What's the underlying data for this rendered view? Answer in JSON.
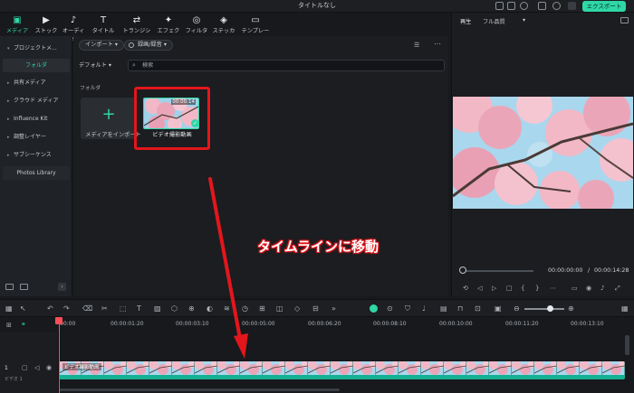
{
  "window": {
    "title": "タイトルなし",
    "export_label": "エクスポート"
  },
  "tabs": [
    {
      "label": "メディア",
      "icon": "media-icon"
    },
    {
      "label": "ストック",
      "icon": "stock-icon"
    },
    {
      "label": "オーディオ",
      "icon": "audio-icon"
    },
    {
      "label": "タイトル",
      "icon": "title-icon"
    },
    {
      "label": "トランジション",
      "icon": "transition-icon"
    },
    {
      "label": "エフェクト",
      "icon": "effect-icon"
    },
    {
      "label": "フィルター",
      "icon": "filter-icon"
    },
    {
      "label": "ステッカー",
      "icon": "sticker-icon"
    },
    {
      "label": "テンプレート",
      "icon": "template-icon"
    }
  ],
  "sidebar": {
    "items": [
      {
        "label": "プロジェクトメ..."
      },
      {
        "label": "フォルダ"
      },
      {
        "label": "共有メディア"
      },
      {
        "label": "クラウド メディア"
      },
      {
        "label": "Influence Kit"
      },
      {
        "label": "調整レイヤー"
      },
      {
        "label": "サブシーケンス"
      },
      {
        "label": "Photos Library"
      }
    ]
  },
  "media": {
    "import_label": "インポート",
    "record_label": "録画/録音",
    "sort_label": "デフォルト",
    "search_placeholder": "検索",
    "folder_label": "フォルダ",
    "import_tile_label": "メディアをインポート",
    "clip": {
      "name": "ビデオ撮影動画",
      "duration": "00:00:14"
    }
  },
  "player": {
    "tab_label": "再生",
    "quality_label": "フル品質",
    "current_time": "00:00:00:00",
    "separator": "/",
    "total_time": "00:00:14:28"
  },
  "timeline": {
    "ruler_labels": [
      "00:00",
      "00:00:01:20",
      "00:00:03:10",
      "00:00:05:00",
      "00:00:06:20",
      "00:00:08:10",
      "00:00:10:00",
      "00:00:11:20",
      "00:00:13:10"
    ],
    "track_clip_label": "ビデオ撮影動画",
    "track_name": "ビデオ 1",
    "track_number": "1"
  },
  "annotation": {
    "text": "タイムラインに移動",
    "color": "#e3161c"
  },
  "colors": {
    "accent": "#2fd6a6",
    "highlight": "#e3161c",
    "blossom": "#f2b8c6",
    "sky": "#9fd2ea"
  }
}
